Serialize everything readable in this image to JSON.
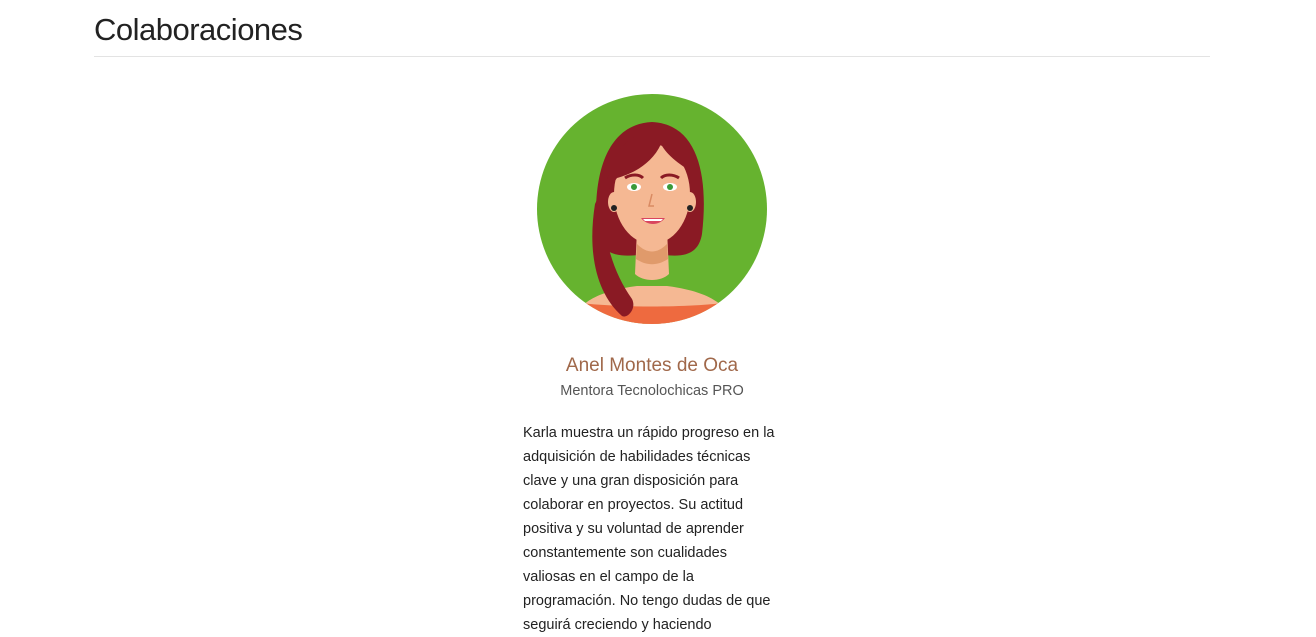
{
  "section": {
    "title": "Colaboraciones"
  },
  "testimonial": {
    "avatar_icon": "woman-avatar-icon",
    "avatar_bg_color": "#66b32f",
    "name": "Anel Montes de Oca",
    "name_color": "#a0684a",
    "role": "Mentora Tecnolochicas PRO",
    "quote": "Karla muestra un rápido progreso en la adquisición de habilidades técnicas clave y una gran disposición para colaborar en proyectos. Su actitud positiva y su voluntad de aprender constantemente son cualidades valiosas en el campo de la programación. No tengo dudas de que seguirá creciendo y haciendo"
  }
}
